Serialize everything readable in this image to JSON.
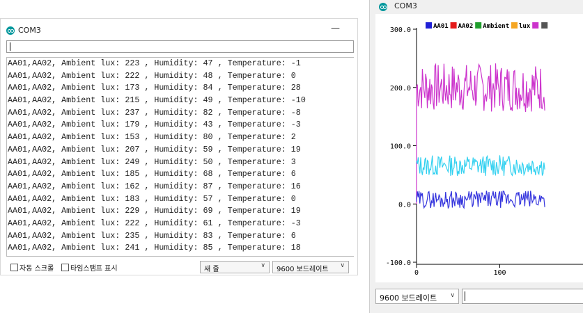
{
  "serial_monitor": {
    "title": "COM3",
    "minimize_symbol": "—",
    "input_value": "",
    "lines": [
      "AA01,AA02, Ambient lux: 223 , Humidity: 47 , Temperature: -1",
      "AA01,AA02, Ambient lux: 222 , Humidity: 48 , Temperature: 0",
      "AA01,AA02, Ambient lux: 173 , Humidity: 84 , Temperature: 28",
      "AA01,AA02, Ambient lux: 215 , Humidity: 49 , Temperature: -10",
      "AA01,AA02, Ambient lux: 237 , Humidity: 82 , Temperature: -8",
      "AA01,AA02, Ambient lux: 179 , Humidity: 43 , Temperature: -3",
      "AA01,AA02, Ambient lux: 153 , Humidity: 80 , Temperature: 2",
      "AA01,AA02, Ambient lux: 207 , Humidity: 59 , Temperature: 19",
      "AA01,AA02, Ambient lux: 249 , Humidity: 50 , Temperature: 3",
      "AA01,AA02, Ambient lux: 185 , Humidity: 68 , Temperature: 6",
      "AA01,AA02, Ambient lux: 162 , Humidity: 87 , Temperature: 16",
      "AA01,AA02, Ambient lux: 183 , Humidity: 57 , Temperature: 0",
      "AA01,AA02, Ambient lux: 229 , Humidity: 69 , Temperature: 19",
      "AA01,AA02, Ambient lux: 222 , Humidity: 61 , Temperature: -3",
      "AA01,AA02, Ambient lux: 235 , Humidity: 83 , Temperature: 6",
      "AA01,AA02, Ambient lux: 241 , Humidity: 85 , Temperature: 18"
    ],
    "autoscroll_label": "자동 스크롤",
    "timestamp_label": "타임스탬프 표시",
    "line_ending": "새 줄",
    "baud_rate": "9600 보드레이트",
    "dropdown_arrow": "∨"
  },
  "serial_plotter": {
    "title": "COM3",
    "baud_rate": "9600 보드레이트",
    "dropdown_arrow": "∨",
    "input_value": "",
    "chart_data": {
      "type": "line",
      "ylim": [
        -100,
        300
      ],
      "y_ticks": [
        300,
        200,
        100,
        0,
        -100
      ],
      "y_tick_labels": [
        "300.0",
        "200.0",
        "100.0",
        "0.0",
        "-100.0"
      ],
      "x_ticks": [
        0,
        100
      ],
      "x_tick_labels": [
        "0",
        "100"
      ],
      "xlim": [
        0,
        210
      ],
      "legend_position": "top",
      "legend": [
        {
          "name": "AA01",
          "color": "#1f1fd6"
        },
        {
          "name": "AA02",
          "color": "#e41b1b"
        },
        {
          "name": "Ambient",
          "color": "#1f9e2c"
        },
        {
          "name": "lux",
          "color": "#f5a623"
        },
        {
          "name": "",
          "color": "#cc33cc"
        },
        {
          "name": "",
          "color": "#555555"
        }
      ],
      "series": [
        {
          "color": "#cc33cc",
          "base": 200,
          "amplitude": 42,
          "seed": 7
        },
        {
          "color": "#33d1f0",
          "base": 66,
          "amplitude": 18,
          "seed": 13
        },
        {
          "color": "#3333dd",
          "base": 8,
          "amplitude": 15,
          "seed": 29
        }
      ],
      "points": 155
    }
  }
}
